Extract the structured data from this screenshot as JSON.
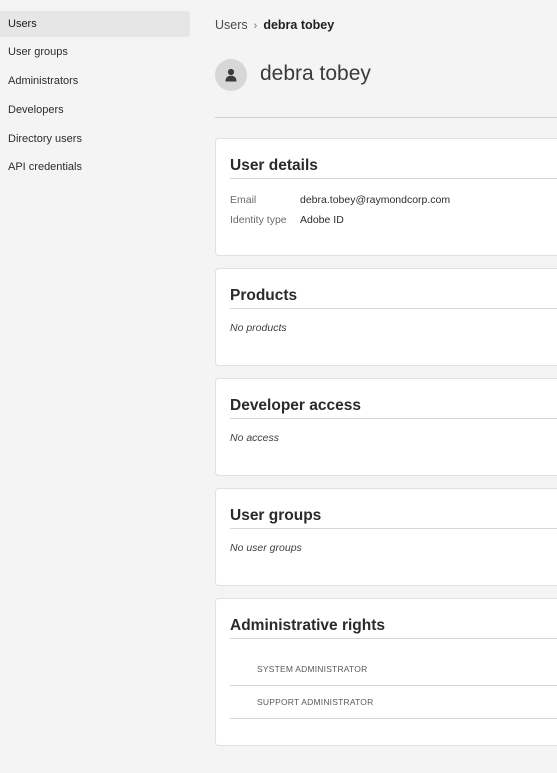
{
  "sidebar": {
    "items": [
      {
        "label": "Users"
      },
      {
        "label": "User groups"
      },
      {
        "label": "Administrators"
      },
      {
        "label": "Developers"
      },
      {
        "label": "Directory users"
      },
      {
        "label": "API credentials"
      }
    ]
  },
  "breadcrumb": {
    "parent": "Users",
    "separator": "›",
    "current": "debra tobey"
  },
  "user": {
    "name": "debra tobey",
    "avatar_icon": "person-icon"
  },
  "user_details": {
    "title": "User details",
    "email_label": "Email",
    "email_value": "debra.tobey@raymondcorp.com",
    "identity_label": "Identity type",
    "identity_value": "Adobe ID"
  },
  "products": {
    "title": "Products",
    "empty": "No products"
  },
  "developer_access": {
    "title": "Developer access",
    "empty": "No access"
  },
  "user_groups": {
    "title": "User groups",
    "empty": "No user groups"
  },
  "admin_rights": {
    "title": "Administrative rights",
    "roles": [
      {
        "label": "SYSTEM ADMINISTRATOR"
      },
      {
        "label": "SUPPORT ADMINISTRATOR"
      }
    ]
  }
}
